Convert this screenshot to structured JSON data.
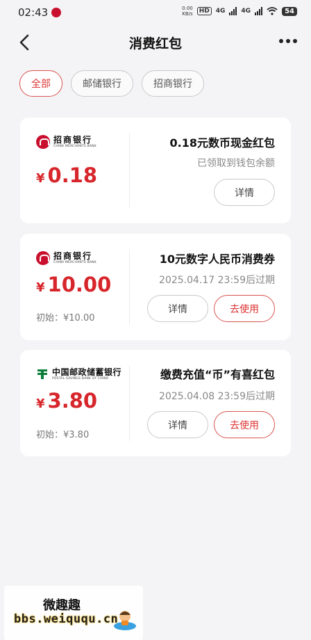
{
  "status_bar": {
    "time": "02:43",
    "net_speed_value": "0.00",
    "net_speed_unit": "KB/s",
    "hd": "HD",
    "net1": "4G",
    "net2": "4G",
    "battery": "54"
  },
  "header": {
    "title": "消费红包"
  },
  "filters": [
    {
      "label": "全部",
      "active": true
    },
    {
      "label": "邮储银行",
      "active": false
    },
    {
      "label": "招商银行",
      "active": false
    }
  ],
  "coupons": [
    {
      "bank_cn": "招商银行",
      "bank_en": "CHINA MERCHANTS BANK",
      "currency": "¥",
      "amount": "0.18",
      "title": "0.18元数币现金红包",
      "subtitle": "已领取到钱包余额",
      "details_label": "详情"
    },
    {
      "bank_cn": "招商银行",
      "bank_en": "CHINA MERCHANTS BANK",
      "currency": "¥",
      "amount": "10.00",
      "initial": "初始：¥10.00",
      "title": "10元数字人民币消费券",
      "subtitle": "2025.04.17 23:59后过期",
      "details_label": "详情",
      "use_label": "去使用"
    },
    {
      "bank_cn": "中国邮政储蓄银行",
      "bank_en": "POSTAL SAVINGS BANK OF CHINA",
      "currency": "¥",
      "amount": "3.80",
      "initial": "初始：¥3.80",
      "title": "缴费充值“币”有喜红包",
      "subtitle": "2025.04.08 23:59后过期",
      "details_label": "详情",
      "use_label": "去使用"
    }
  ],
  "watermark": {
    "title": "微趣趣",
    "url": "bbs.weiququ.cn"
  },
  "colors": {
    "accent": "#d7262b",
    "background": "#f4f4f6",
    "card": "#ffffff"
  }
}
